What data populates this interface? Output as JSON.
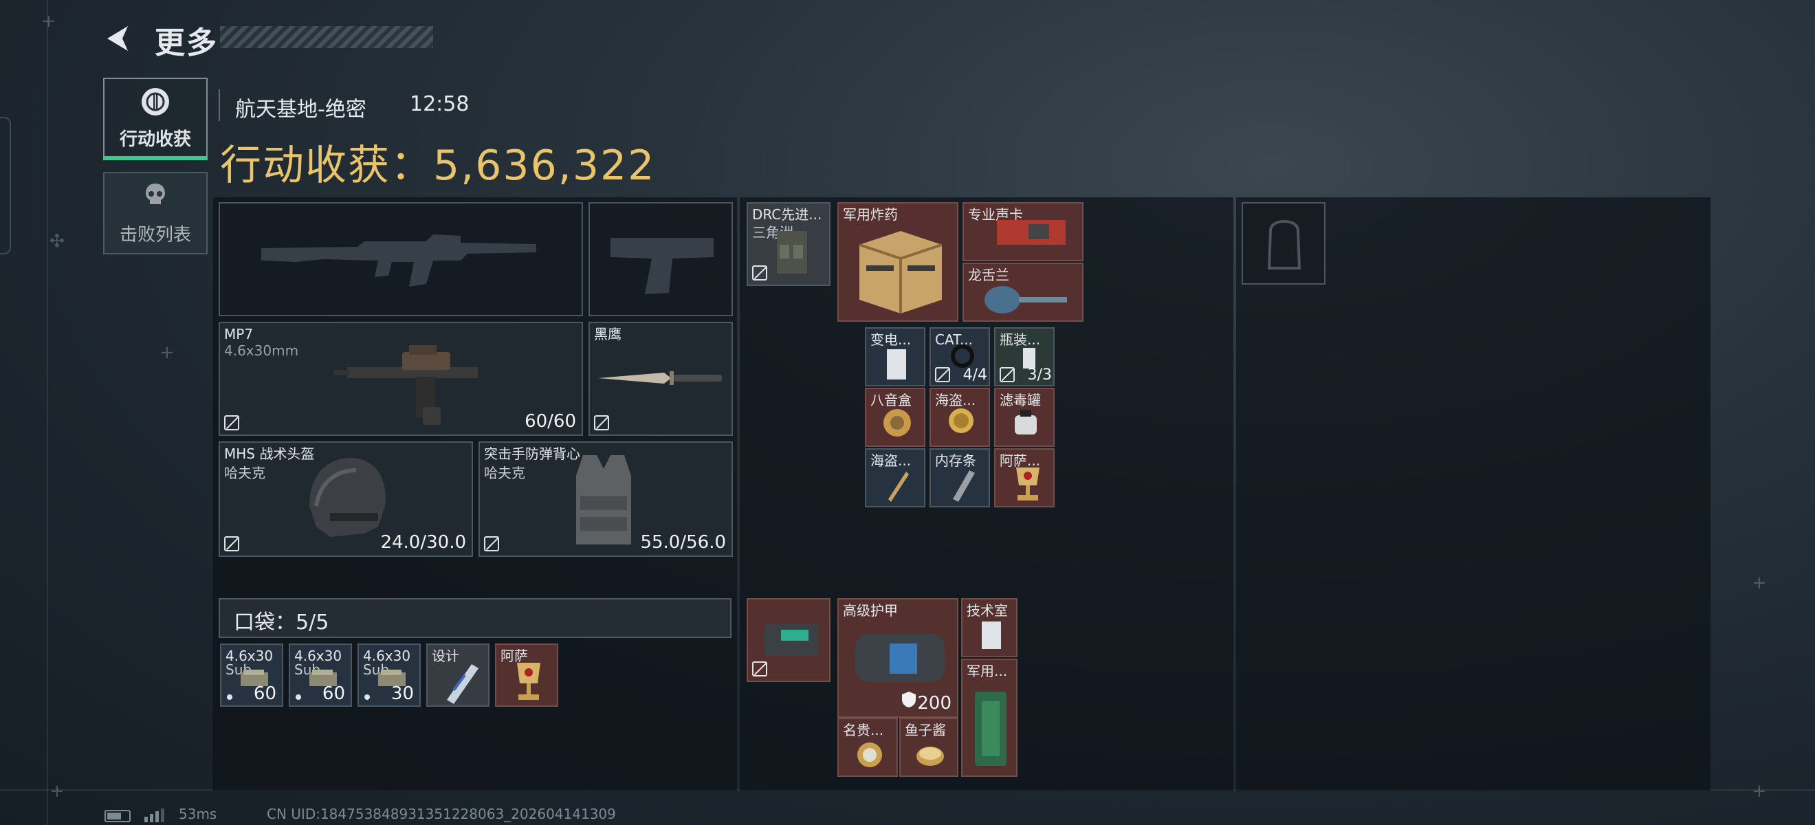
{
  "header": {
    "title": "更多"
  },
  "nav": {
    "tabs": [
      {
        "label": "行动收获",
        "icon": "loot-icon",
        "active": true
      },
      {
        "label": "击败列表",
        "icon": "skull-icon",
        "active": false
      }
    ]
  },
  "match": {
    "map": "航天基地-绝密",
    "time": "12:58",
    "gain_label": "行动收获：5,636,322"
  },
  "equipment": {
    "primary_1": {
      "name": "",
      "empty": true
    },
    "pistol": {
      "name": "",
      "empty": true
    },
    "primary_2": {
      "name": "MP7",
      "ammo_type": "4.6x30mm",
      "ammo": "60/60"
    },
    "melee": {
      "name": "黑鹰"
    },
    "helmet": {
      "name": "MHS 战术头盔",
      "brand": "哈夫克",
      "durability": "24.0/30.0"
    },
    "armor": {
      "name": "突击手防弹背心",
      "brand": "哈夫克",
      "durability": "55.0/56.0"
    }
  },
  "pocket": {
    "label": "口袋：5/5",
    "items": [
      {
        "name": "4.6x30",
        "name2": "Sub...",
        "count": "60"
      },
      {
        "name": "4.6x30",
        "name2": "Sub...",
        "count": "60"
      },
      {
        "name": "4.6x30",
        "name2": "Sub...",
        "count": "30"
      },
      {
        "name": "设计"
      },
      {
        "name": "阿萨"
      }
    ]
  },
  "chest_rig": {
    "rig": {
      "name": "DRC先进...",
      "name2": "三角洲"
    },
    "items": [
      {
        "name": "军用炸药"
      },
      {
        "name": "专业声卡"
      },
      {
        "name": "龙舌兰"
      },
      {
        "name": "变电..."
      },
      {
        "name": "CAT...",
        "count": "4/4"
      },
      {
        "name": "瓶装...",
        "count": "3/3"
      },
      {
        "name": "八音盒"
      },
      {
        "name": "海盗..."
      },
      {
        "name": "滤毒罐"
      },
      {
        "name": "海盗..."
      },
      {
        "name": "内存条"
      },
      {
        "name": "阿萨..."
      }
    ]
  },
  "backpack": {
    "items": [
      {
        "name": "高级护甲",
        "value": "200"
      },
      {
        "name": "技术室"
      },
      {
        "name": "军用..."
      },
      {
        "name": "名贵..."
      },
      {
        "name": "鱼子酱"
      }
    ]
  },
  "status": {
    "ping": "53ms",
    "uid": "CN UID:1847538489313512280​63_202604141309"
  }
}
